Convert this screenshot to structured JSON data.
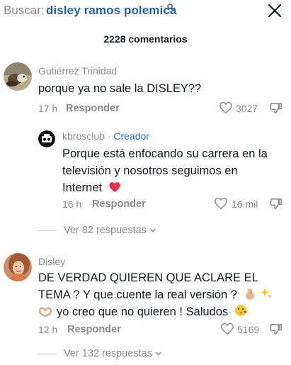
{
  "search": {
    "label": "Buscar:",
    "query": "disley ramos polemica"
  },
  "comments_header": {
    "count_label": "2228 comentarios"
  },
  "comments": [
    {
      "username": "Gutiérrez Trinidad",
      "text": "porque ya no sale la DISLEY??",
      "time": "17 h",
      "reply_label": "Responder",
      "likes": "3027",
      "avatar_icon": "bird-photo-avatar"
    },
    {
      "username": "kbrosclub",
      "creator_label": "Creador",
      "separator": " · ",
      "text_line1": "Porque está enfocando su carrera en la",
      "text_line2": "televisión y nosotros seguimos en",
      "text_line3": "Internet",
      "time": "16 h",
      "reply_label": "Responder",
      "likes": "16 mil",
      "view_replies": "Ver 82 respuestas",
      "avatar_icon": "kbros-logo-avatar"
    },
    {
      "username": "Disley",
      "text_line1": "DE VERDAD QUIEREN QUE ACLARE EL",
      "text_line2": "TEMA ? Y que cuente la real versión ?",
      "text_line3": "yo creo que no quieren ! Saludos",
      "time": "12 h",
      "reply_label": "Responder",
      "likes": "5169",
      "view_replies": "Ver 132 respuestas",
      "avatar_icon": "woman-photo-avatar"
    }
  ],
  "colors": {
    "query_blue": "#2b5da8",
    "creator_blue": "#2b6fd6",
    "muted_gray": "#8a8b91",
    "text_dark": "#161823",
    "heart_red": "#e8314a"
  }
}
